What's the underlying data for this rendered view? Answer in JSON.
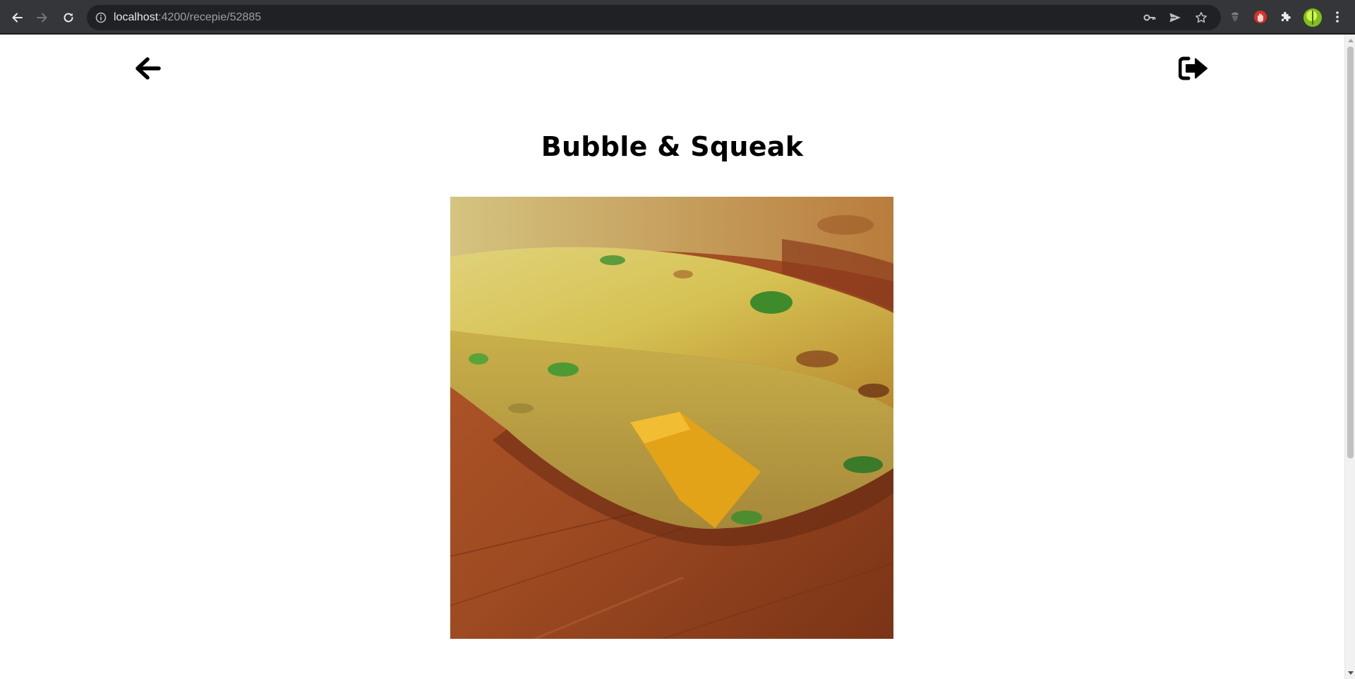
{
  "browser": {
    "url_host": "localhost",
    "url_path": ":4200/recepie/52885",
    "icons": {
      "back": "back-arrow-icon",
      "forward": "forward-arrow-icon",
      "reload": "reload-icon",
      "site_info": "info-circle-icon",
      "password": "key-icon",
      "send": "send-icon",
      "bookmark": "star-icon",
      "extension_1": "acorn-icon",
      "extension_2": "red-hand-icon",
      "extensions": "puzzle-icon",
      "profile": "avatar-icon",
      "menu": "kebab-menu-icon"
    }
  },
  "page": {
    "back_icon": "arrow-left-icon",
    "logout_icon": "sign-out-icon",
    "recipe": {
      "title": "Bubble & Squeak",
      "image_alt": "Bubble & Squeak"
    }
  },
  "colors": {
    "chrome_bg": "#35363a",
    "omnibox_bg": "#202124",
    "page_bg": "#ffffff",
    "text": "#000000"
  }
}
